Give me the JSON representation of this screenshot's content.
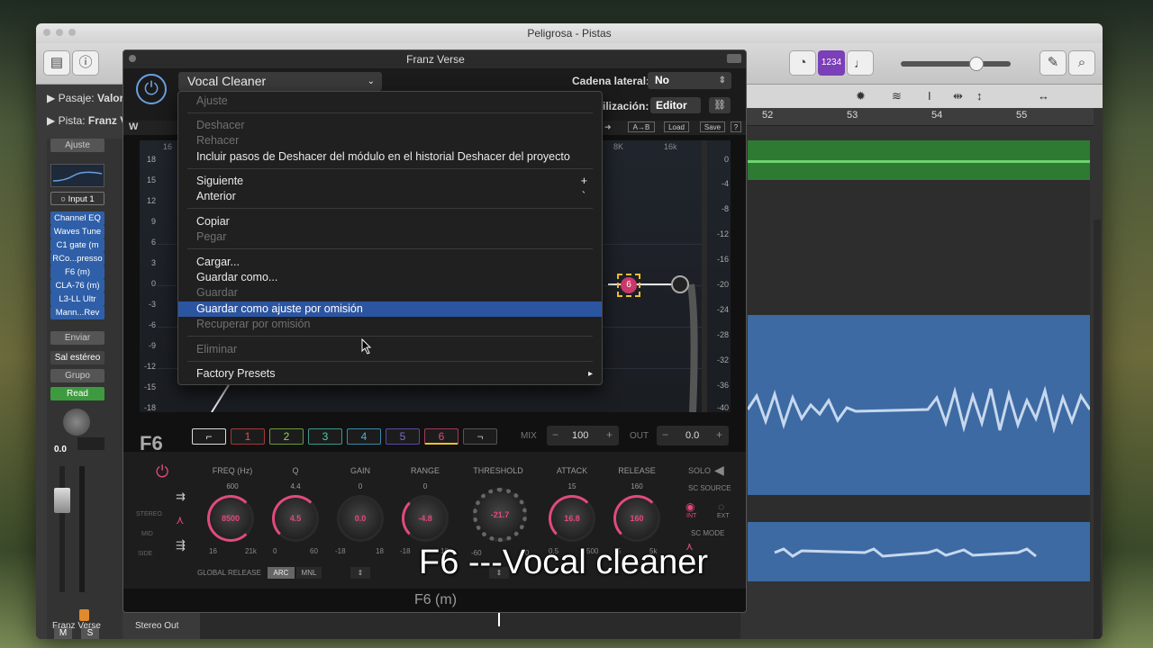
{
  "logic": {
    "title": "Peligrosa - Pistas",
    "inspector": {
      "pasaje_label": "Pasaje:",
      "pasaje_value": "Valore",
      "pista_label": "Pista:",
      "pista_value": "Franz V",
      "ajuste": "Ajuste",
      "input": "Input 1",
      "plugins": [
        "Channel EQ",
        "Waves Tune",
        "C1 gate (m",
        "RCo...presso",
        "F6 (m)",
        "CLA-76 (m)",
        "L3-LL Ultr",
        "Mann...Rev"
      ],
      "enviar": "Enviar",
      "output": "Sal estéreo",
      "grupo": "Grupo",
      "automation": "Read",
      "pan_value": "0.0",
      "mute": "M",
      "solo": "S",
      "track_name": "Franz Verse",
      "out_name": "Stereo Out"
    },
    "toolbar": {
      "lcd_badge": "1234"
    },
    "ruler": [
      "52",
      "53",
      "54",
      "55"
    ]
  },
  "plugin": {
    "window_title": "Franz Verse",
    "preset": "Vocal Cleaner",
    "sidechain_label": "Cadena lateral:",
    "sidechain_value": "No",
    "view_label": "ilización:",
    "view_value": "Editor",
    "toolbar": {
      "ab": "A→B",
      "load": "Load",
      "save": "Save",
      "help": "?"
    },
    "freq_labels": [
      "16",
      "8K",
      "16k"
    ],
    "db_left": [
      "18",
      "15",
      "12",
      "9",
      "6",
      "3",
      "0",
      "-3",
      "-6",
      "-9",
      "-12",
      "-15",
      "-18"
    ],
    "db_right": [
      "0",
      "-4",
      "-8",
      "-12",
      "-16",
      "-20",
      "-24",
      "-28",
      "-32",
      "-36",
      "-40"
    ],
    "logo": "F6",
    "bands": [
      "1",
      "2",
      "3",
      "4",
      "5",
      "6"
    ],
    "mix_label": "MIX",
    "mix_value": "100",
    "out_label": "OUT",
    "out_value": "0.0",
    "controls": {
      "labels": [
        "FREQ (Hz)",
        "Q",
        "GAIN",
        "RANGE",
        "THRESHOLD",
        "ATTACK",
        "RELEASE"
      ],
      "values": [
        "8500",
        "4.5",
        "0.0",
        "-4.8",
        "-21.7",
        "16.8",
        "160"
      ],
      "tops": [
        "600",
        "4.4",
        "0",
        "0",
        "",
        "15",
        "160"
      ],
      "mins": [
        "16",
        "0",
        "-18",
        "-18",
        "-60",
        "0.5",
        "5"
      ],
      "maxs": [
        "21k",
        "60",
        "18",
        "18",
        "0",
        "500",
        "5k"
      ],
      "solo": "SOLO",
      "sc_source": "SC SOURCE",
      "int": "INT",
      "ext": "EXT",
      "sc_mode": "SC MODE",
      "global_release": "GLOBAL RELEASE",
      "arc": "ARC",
      "mnl": "MNL",
      "stereo": "STEREO",
      "mid": "MID",
      "side": "SIDE"
    },
    "footer": "F6 (m)",
    "active_band_marker": "6"
  },
  "menu": {
    "items": [
      {
        "label": "Ajuste",
        "enabled": false
      },
      {
        "label": "Deshacer",
        "enabled": false
      },
      {
        "label": "Rehacer",
        "enabled": false
      },
      {
        "label": "Incluir pasos de Deshacer del módulo en el historial Deshacer del proyecto",
        "enabled": true
      },
      {
        "label": "Siguiente",
        "enabled": true,
        "shortcut": "+"
      },
      {
        "label": "Anterior",
        "enabled": true,
        "shortcut": "`"
      },
      {
        "label": "Copiar",
        "enabled": true
      },
      {
        "label": "Pegar",
        "enabled": false
      },
      {
        "label": "Cargar...",
        "enabled": true
      },
      {
        "label": "Guardar como...",
        "enabled": true
      },
      {
        "label": "Guardar",
        "enabled": false
      },
      {
        "label": "Guardar como ajuste por omisión",
        "enabled": true,
        "selected": true
      },
      {
        "label": "Recuperar por omisión",
        "enabled": false
      },
      {
        "label": "Eliminar",
        "enabled": false
      },
      {
        "label": "Factory Presets",
        "enabled": true,
        "submenu": "▸"
      }
    ]
  },
  "caption": "F6 ---Vocal cleaner",
  "colors": {
    "accent": "#e04b7a",
    "menu_highlight": "#2c55a1",
    "region_green": "#3a8a3a",
    "region_blue": "#3d6aa3"
  }
}
